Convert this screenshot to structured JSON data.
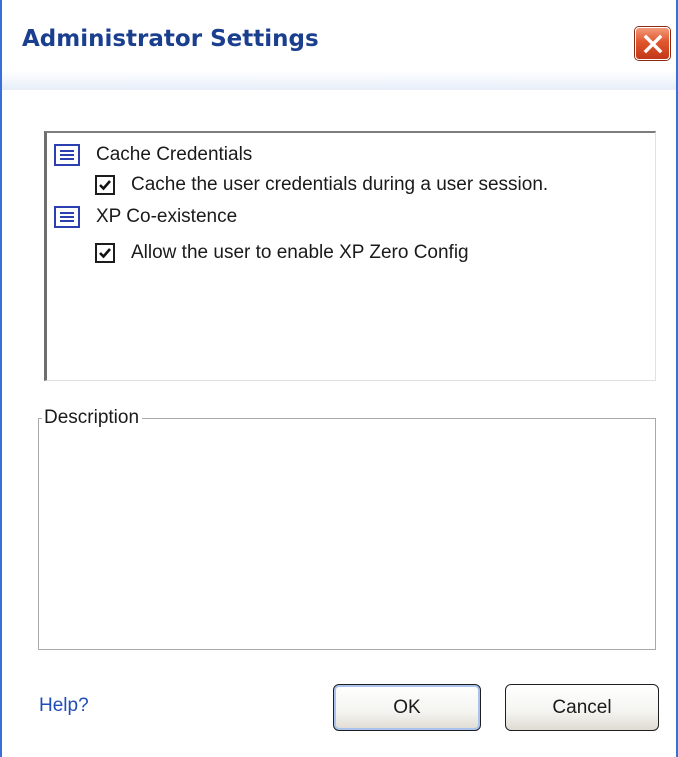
{
  "window": {
    "title": "Administrator Settings",
    "close_icon": "close-x-icon",
    "accent_color": "#1b3f8f"
  },
  "tree": {
    "sections": [
      {
        "label": "Cache Credentials",
        "icon": "list-section-icon",
        "options": [
          {
            "label": "Cache the user credentials during a user session.",
            "checked": true
          }
        ]
      },
      {
        "label": "XP Co-existence",
        "icon": "list-section-icon",
        "options": [
          {
            "label": "Allow the user to enable XP Zero Config",
            "checked": true
          }
        ]
      }
    ]
  },
  "description": {
    "legend": "Description",
    "text": ""
  },
  "footer": {
    "help_label": "Help?",
    "ok_label": "OK",
    "cancel_label": "Cancel"
  }
}
